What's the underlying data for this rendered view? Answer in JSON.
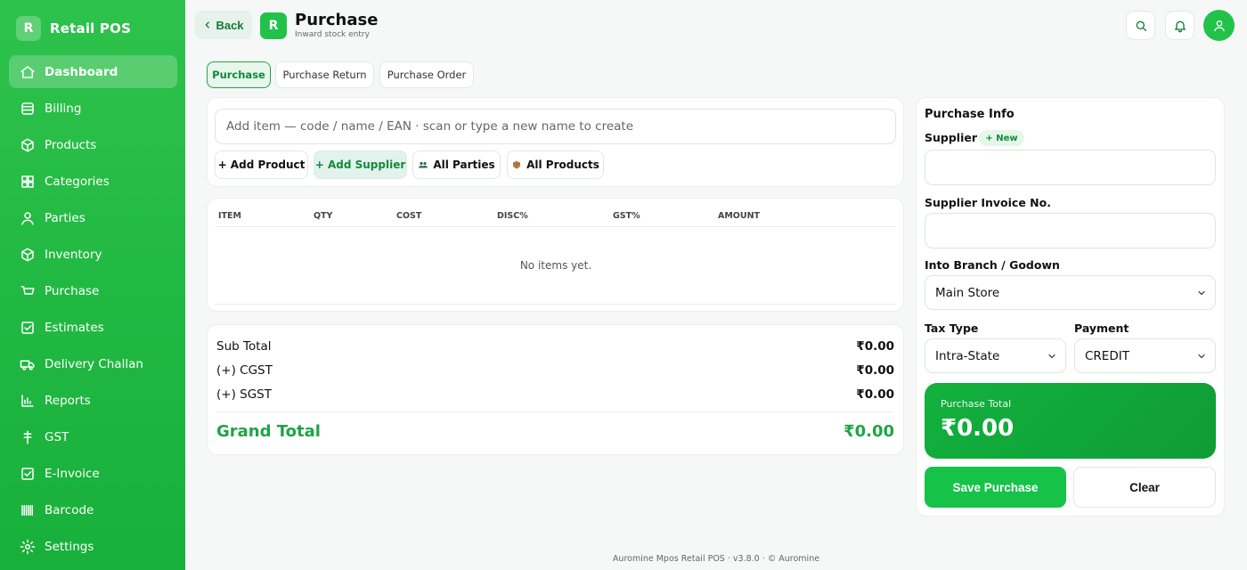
{
  "brand": {
    "badge": "R",
    "name": "Retail POS"
  },
  "sidebar": {
    "items": [
      {
        "label": "Dashboard",
        "icon": "home-icon",
        "active": true
      },
      {
        "label": "Billing",
        "icon": "billing-icon"
      },
      {
        "label": "Products",
        "icon": "box-icon"
      },
      {
        "label": "Categories",
        "icon": "grid-icon"
      },
      {
        "label": "Parties",
        "icon": "user-icon"
      },
      {
        "label": "Inventory",
        "icon": "cube-icon"
      },
      {
        "label": "Purchase",
        "icon": "cart-icon"
      },
      {
        "label": "Estimates",
        "icon": "checkbox-icon"
      },
      {
        "label": "Delivery Challan",
        "icon": "truck-icon"
      },
      {
        "label": "Reports",
        "icon": "bar-chart-icon"
      },
      {
        "label": "GST",
        "icon": "rupee-icon"
      },
      {
        "label": "E-Invoice",
        "icon": "receipt-icon"
      },
      {
        "label": "Barcode",
        "icon": "barcode-icon"
      },
      {
        "label": "Settings",
        "icon": "gear-icon"
      }
    ]
  },
  "header": {
    "back_label": "Back",
    "badge": "R",
    "title": "Purchase",
    "subtitle": "Inward stock entry"
  },
  "tabs": [
    {
      "label": "Purchase",
      "active": true
    },
    {
      "label": "Purchase Return"
    },
    {
      "label": "Purchase Order"
    }
  ],
  "search": {
    "placeholder": "Add item — code / name / EAN · scan or type a new name to create",
    "value": ""
  },
  "actions": {
    "add_product": "+ Add Product",
    "add_supplier": "+ Add Supplier",
    "all_parties": "All Parties",
    "all_products": "All Products"
  },
  "table": {
    "columns": [
      "ITEM",
      "QTY",
      "COST",
      "DISC%",
      "GST%",
      "AMOUNT"
    ],
    "empty_message": "No items yet."
  },
  "totals": {
    "sub_total_label": "Sub Total",
    "sub_total": "₹0.00",
    "cgst_label": "(+) CGST",
    "cgst": "₹0.00",
    "sgst_label": "(+) SGST",
    "sgst": "₹0.00",
    "grand_label": "Grand Total",
    "grand": "₹0.00"
  },
  "purchase_info": {
    "title": "Purchase Info",
    "supplier_label": "Supplier",
    "new_label": "+ New",
    "supplier_value": "",
    "invoice_label": "Supplier Invoice No.",
    "invoice_value": "",
    "branch_label": "Into Branch / Godown",
    "branch_value": "Main Store",
    "tax_type_label": "Tax Type",
    "tax_type_value": "Intra-State",
    "payment_label": "Payment",
    "payment_value": "CREDIT",
    "total_label": "Purchase Total",
    "total_value": "₹0.00",
    "save_label": "Save Purchase",
    "clear_label": "Clear"
  },
  "footer": "Auromine Mpos Retail POS · v3.8.0 · © Auromine",
  "colors": {
    "accent": "#1fb543",
    "sidebar_bg": "#22bb45",
    "accent_dark": "#0f9c36"
  }
}
